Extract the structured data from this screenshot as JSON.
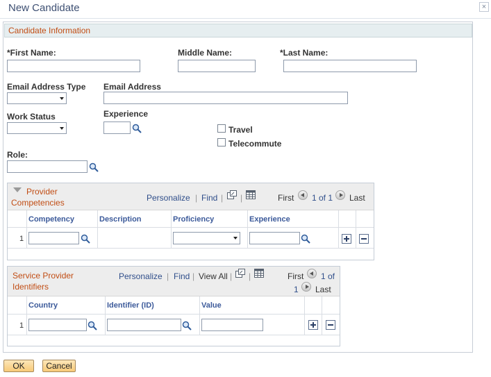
{
  "dialog": {
    "title": "New Candidate",
    "close_label": "×"
  },
  "section": {
    "title": "Candidate Information"
  },
  "form": {
    "first_name_label": "*First Name:",
    "middle_name_label": "Middle Name:",
    "last_name_label": "*Last Name:",
    "email_type_label": "Email Address Type",
    "email_label": "Email Address",
    "work_status_label": "Work Status",
    "experience_label": "Experience",
    "travel_label": "Travel",
    "telecommute_label": "Telecommute",
    "role_label": "Role:"
  },
  "competencies": {
    "title_line1": "Provider",
    "title_line2": "Competencies",
    "personalize": "Personalize",
    "find": "Find",
    "first": "First",
    "range": "1 of 1",
    "last": "Last",
    "columns": [
      "Competency",
      "Description",
      "Proficiency",
      "Experience"
    ],
    "rows": [
      {
        "num": "1"
      }
    ]
  },
  "identifiers": {
    "title_line1": "Service Provider",
    "title_line2": "Identifiers",
    "personalize": "Personalize",
    "find": "Find",
    "view_all": "View All",
    "first": "First",
    "range_a": "1 of",
    "range_b": "1",
    "last": "Last",
    "columns": [
      "Country",
      "Identifier (ID)",
      "Value"
    ],
    "rows": [
      {
        "num": "1"
      }
    ]
  },
  "buttons": {
    "ok": "OK",
    "cancel": "Cancel"
  }
}
